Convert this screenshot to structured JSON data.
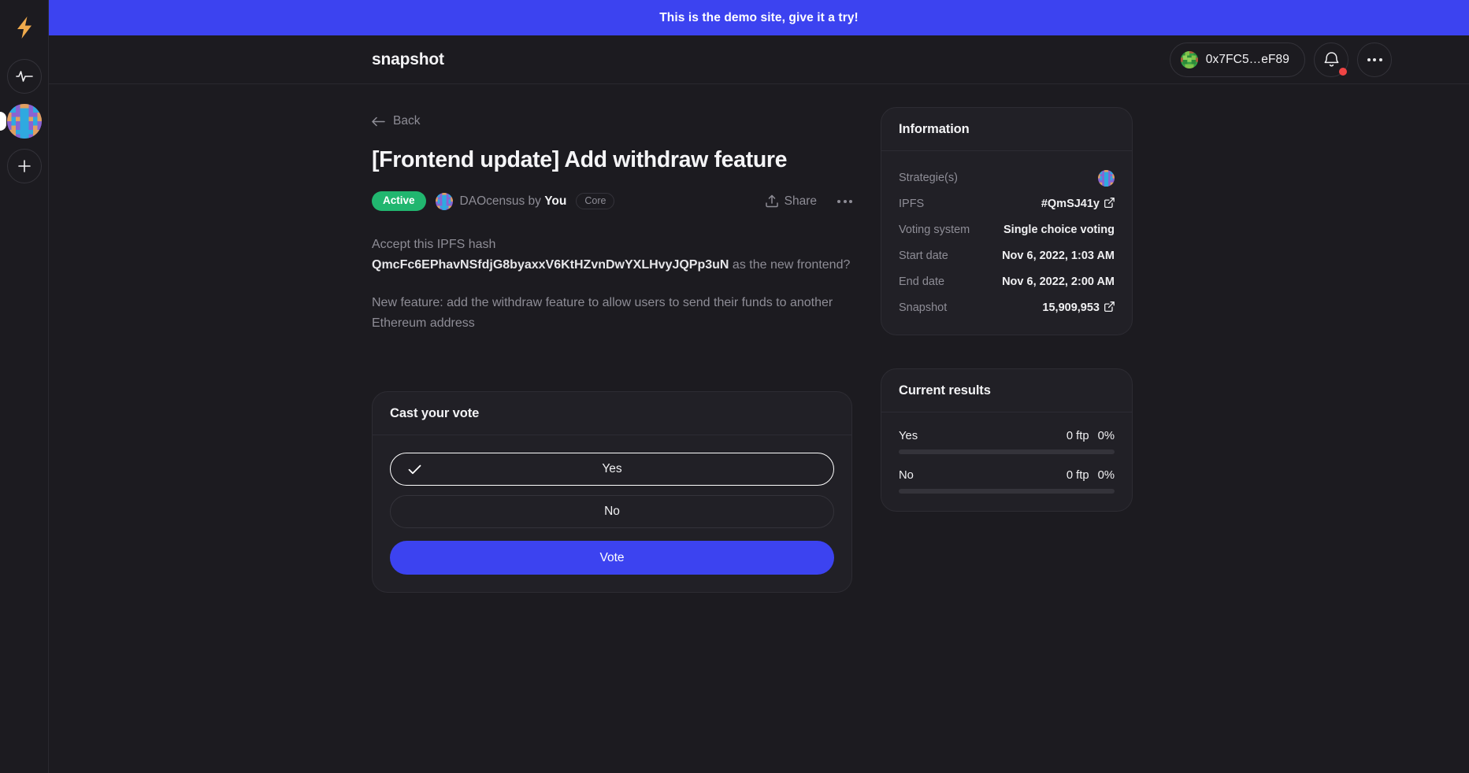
{
  "banner": {
    "text": "This is the demo site, give it a try!",
    "bg": "#3c43f0"
  },
  "rail": {
    "logo_icon": "lightning-bolt-icon",
    "items": [
      {
        "icon": "activity-pulse-icon",
        "label": ""
      },
      {
        "icon": "dao-avatar-icon",
        "label": "",
        "active": true
      },
      {
        "icon": "plus-icon",
        "label": ""
      }
    ]
  },
  "topbar": {
    "brand": "snapshot",
    "account": {
      "address": "0x7FC5…eF89",
      "avatar_icon": "jazzicon-avatar"
    },
    "notifications_icon": "bell-icon",
    "notifications_has_unread": true,
    "more_icon": "more-horizontal-icon"
  },
  "main": {
    "back_label": "Back",
    "back_icon": "arrow-left-icon",
    "title": "[Frontend update] Add withdraw feature",
    "state_badge": "Active",
    "author": {
      "space": "DAOcensus",
      "by": "by",
      "name": "You",
      "role_badge": "Core"
    },
    "share_label": "Share",
    "share_icon": "share-upload-icon",
    "more_icon": "more-horizontal-icon",
    "body": {
      "line1_prefix": "Accept this IPFS hash ",
      "ipfs_hash": "QmcFc6EPhavNSfdjG8byaxxV6KtHZvnDwYXLHvyJQPp3uN",
      "line1_suffix": " as the new frontend?",
      "paragraph2": "New feature: add the withdraw feature to allow users to send their funds to another Ethereum address"
    }
  },
  "vote_card": {
    "title": "Cast your vote",
    "choices": [
      {
        "label": "Yes",
        "selected": true,
        "check_icon": "check-icon"
      },
      {
        "label": "No",
        "selected": false
      }
    ],
    "submit_label": "Vote",
    "submit_color": "#3c43f0"
  },
  "information": {
    "title": "Information",
    "rows": [
      {
        "key": "Strategie(s)",
        "value": "",
        "type": "avatar",
        "icon": "strategy-avatar-icon"
      },
      {
        "key": "IPFS",
        "value": "#QmSJ41y",
        "type": "link",
        "icon": "external-link-icon"
      },
      {
        "key": "Voting system",
        "value": "Single choice voting",
        "type": "text"
      },
      {
        "key": "Start date",
        "value": "Nov 6, 2022, 1:03 AM",
        "type": "text"
      },
      {
        "key": "End date",
        "value": "Nov 6, 2022, 2:00 AM",
        "type": "text"
      },
      {
        "key": "Snapshot",
        "value": "15,909,953",
        "type": "link",
        "icon": "external-link-icon"
      }
    ]
  },
  "results": {
    "title": "Current results",
    "items": [
      {
        "name": "Yes",
        "score": "0 ftp",
        "percent": "0%",
        "percent_value": 0
      },
      {
        "name": "No",
        "score": "0 ftp",
        "percent": "0%",
        "percent_value": 0
      }
    ]
  }
}
